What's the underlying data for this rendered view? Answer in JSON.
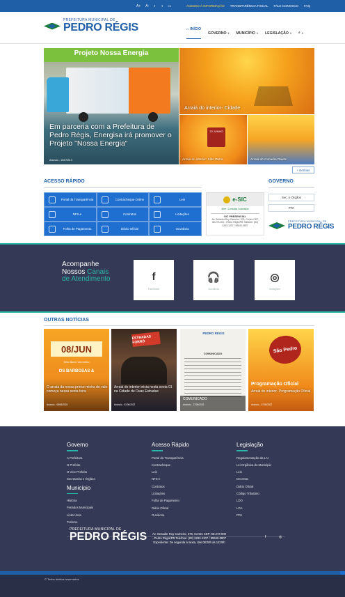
{
  "topbar": {
    "a11y": [
      "A+",
      "A-",
      "◐",
      "◑",
      "▭"
    ],
    "links": [
      "ACESSO À INFORMAÇÃO",
      "TRANSPARÊNCIA FISCAL",
      "FALE CONOSCO",
      "FAQ"
    ]
  },
  "header": {
    "logo_small": "PREFEITURA MUNICIPAL DE",
    "logo_big": "PEDRO RÉGIS",
    "nav": [
      "INÍCIO",
      "GOVERNO",
      "MUNICÍPIO",
      "LEGISLAÇÃO"
    ]
  },
  "hero": {
    "main_banner": "Projeto Nossa Energia",
    "main_caption": "Em parceria com a Prefeitura de Pedro Régis, Energisa irá promover o Projeto \"Nossa Energia\"",
    "main_meta": "Anúncio - 10/07/20 0",
    "big_caption": "Arraiá do interior- Cidade",
    "s1_caption": "Arraiá do interior: Sítio Outra",
    "s1_badge": "23 JUNHO",
    "s2_caption": "Arraiá do comadre Daura",
    "more_label": "+ Notícias"
  },
  "quick": {
    "title": "ACESSO RÁPIDO",
    "items": [
      "Portal da Transparência",
      "Contracheque Online",
      "Leis",
      "NFS-e",
      "Contratos",
      "Licitações",
      "Folha de Pagamento",
      "Diário Oficial",
      "Ouvidoria"
    ]
  },
  "esic": {
    "brand": "e-SIC",
    "sub": "Abrir / Consultar Solicitação",
    "box_title": "SIC PRESENCIAL",
    "box_text": "Av. Senador Ruy Carneiro, 378, Centro CEP 58.273-000 - Pedro Régis/PB Telefone: (83) 3293-1207 / 99540-0807"
  },
  "governo": {
    "title": "GOVERNO",
    "buttons": [
      "Sec. e Órgãos",
      "PPA"
    ],
    "logo_small": "PREFEITURA MUNICIPAL DE",
    "logo_big": "PEDRO RÉGIS"
  },
  "social": {
    "title_line1": "Acompanhe",
    "title_line2a": "Nossos",
    "title_line2b": "Canais",
    "title_line3a": "de",
    "title_line3b": "Atendimento",
    "cards": [
      {
        "glyph": "f",
        "name": "Facebook"
      },
      {
        "glyph": "🎧",
        "name": "Ouvidoria"
      },
      {
        "glyph": "◎",
        "name": "Instagram"
      }
    ]
  },
  "news": {
    "title": "OUTRAS NOTÍCIAS",
    "items": [
      {
        "caption": "O arraiá da nossa prince minha do vale começa nessa sexta feira",
        "meta": "Anúncio - 08/06/2022",
        "date_badge": "08/JUN",
        "sub1": "Sítio Barro Vermelho",
        "sub2": "OS BARBOSAS &"
      },
      {
        "caption": "Arraiá do interior inicia nesta sexta 01 na Cidade de Duas Estradas",
        "meta": "Anúncio - 01/06/2022",
        "tag": "ESTRADAS FORRÓ"
      },
      {
        "caption": "COMUNICADO",
        "meta": "Anúncio - 27/05/2022",
        "doc_head": "PEDRO RÉGIS",
        "doc_title": "COMUNICADO"
      },
      {
        "caption": "Arraiá do interior- Programação Oficial",
        "meta": "Anúncio - 27/05/2022",
        "badge": "São Pedro",
        "big": "Programação Oficial"
      }
    ]
  },
  "footer": {
    "col1_title": "Governo",
    "col1_links": [
      "A Prefeitura",
      "O Prefeito",
      "O Vice-Prefeito",
      "Secretarias e Órgãos"
    ],
    "col1b_title": "Município",
    "col1b_links": [
      "História",
      "Feriados Municipais",
      "Links Úteis",
      "Turismo"
    ],
    "col2_title": "Acesso Rápido",
    "col2_links": [
      "Portal da Transparência",
      "Contracheque",
      "Leis",
      "NFS-e",
      "Contratos",
      "Licitações",
      "Folha de Pagamento",
      "Diário Oficial",
      "Ouvidoria"
    ],
    "col3_title": "Legislação",
    "col3_links": [
      "Regulamentação da LAI",
      "Lei Orgânica do Município",
      "Leis",
      "Decretos",
      "Diário Oficial",
      "Código Tributário",
      "LDO",
      "LOA",
      "PPA"
    ],
    "logo_small": "PREFEITURA MUNICIPAL DE",
    "logo_big": "PEDRO RÉGIS",
    "address": "Av. Senador Ruy Carneiro, 378, Centro CEP: 58.273-000 - Pedro Régis/PB Telefone: (83) 3293-1207 / 99540-0807 Expediente: De segunda à sexta, das 08:00h às 13:00h",
    "social": [
      "f",
      "◎"
    ],
    "bottom": "© Todos direitos reservados"
  }
}
